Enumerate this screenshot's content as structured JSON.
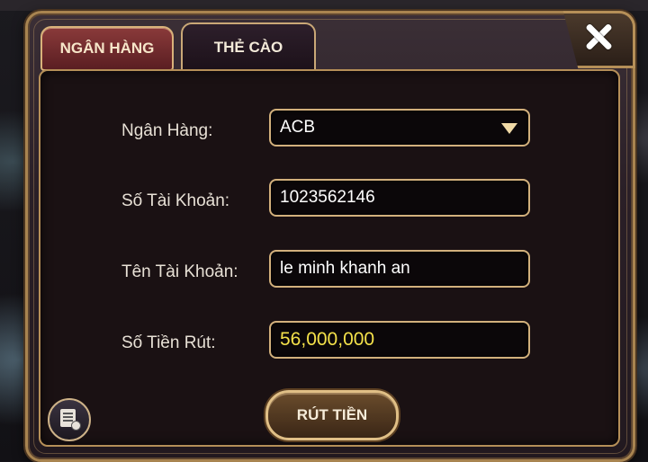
{
  "tabs": [
    {
      "label": "NGÂN HÀNG",
      "active": true
    },
    {
      "label": "THẺ CÀO",
      "active": false
    }
  ],
  "form": {
    "bank_label": "Ngân Hàng:",
    "bank_value": "ACB",
    "account_number_label": "Số Tài Khoản:",
    "account_number_value": "1023562146",
    "account_name_label": "Tên Tài Khoản:",
    "account_name_value": "le minh khanh an",
    "amount_label": "Số Tiền Rút:",
    "amount_value": "56,000,000"
  },
  "buttons": {
    "withdraw_label": "RÚT TIỀN"
  },
  "icons": {
    "close": "close-icon",
    "dropdown": "chevron-down-icon",
    "history": "history-icon"
  },
  "colors": {
    "frame_gold": "#b58f58",
    "amount_text": "#f4e14a",
    "active_tab": "#8a3a3a"
  }
}
